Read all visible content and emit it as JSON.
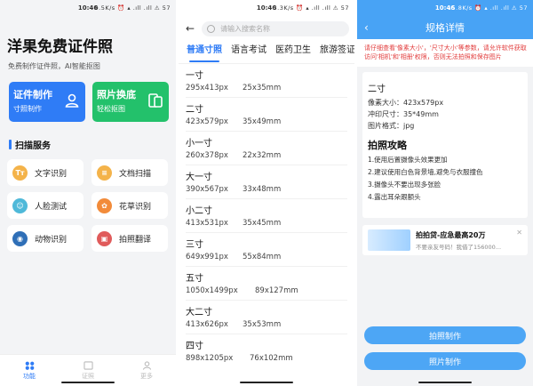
{
  "phone1": {
    "status": {
      "time": "10:46",
      "icons": "0.5K/s ⏰ ▴ .ıll .ıll ⚠ 57"
    },
    "title": "洋果免费证件照",
    "subtitle": "免费制作证件照，AI智能抠图",
    "card_make": {
      "title": "证件制作",
      "sub": "寸照制作"
    },
    "card_bg": {
      "title": "照片换底",
      "sub": "轻松抠图"
    },
    "section_title": "扫描服务",
    "services": [
      {
        "label": "文字识别",
        "icon": "Tт",
        "color": "#f4b34a"
      },
      {
        "label": "文档扫描",
        "icon": "≡",
        "color": "#f4b34a"
      },
      {
        "label": "人脸测试",
        "icon": "☺",
        "color": "#4fb9d9"
      },
      {
        "label": "花草识别",
        "icon": "✿",
        "color": "#f28b3a"
      },
      {
        "label": "动物识别",
        "icon": "◉",
        "color": "#2f6fb7"
      },
      {
        "label": "拍照翻译",
        "icon": "▣",
        "color": "#e05b5b"
      }
    ],
    "tabs": [
      {
        "label": "功能",
        "active": true
      },
      {
        "label": "证照",
        "active": false
      },
      {
        "label": "更多",
        "active": false
      }
    ]
  },
  "phone2": {
    "status": {
      "time": "10:46",
      "icons": "3.3K/s ⏰ ▴ .ıll .ıll ⚠ 57"
    },
    "search_placeholder": "请输入搜索名称",
    "categories": [
      "普通寸照",
      "语言考试",
      "医药卫生",
      "旅游签证"
    ],
    "sizes": [
      {
        "name": "一寸",
        "px": "295x413px",
        "mm": "25x35mm"
      },
      {
        "name": "二寸",
        "px": "423x579px",
        "mm": "35x49mm"
      },
      {
        "name": "小一寸",
        "px": "260x378px",
        "mm": "22x32mm"
      },
      {
        "name": "大一寸",
        "px": "390x567px",
        "mm": "33x48mm"
      },
      {
        "name": "小二寸",
        "px": "413x531px",
        "mm": "35x45mm"
      },
      {
        "name": "三寸",
        "px": "649x991px",
        "mm": "55x84mm"
      },
      {
        "name": "五寸",
        "px": "1050x1499px",
        "mm": "89x127mm"
      },
      {
        "name": "大二寸",
        "px": "413x626px",
        "mm": "35x53mm"
      },
      {
        "name": "四寸",
        "px": "898x1205px",
        "mm": "76x102mm"
      }
    ]
  },
  "phone3": {
    "status": {
      "time": "10:46",
      "icons": "15.8K/s ⏰ ▴ .ıll .ıll ⚠ 57"
    },
    "title": "规格详情",
    "warning": "请仔细查看'像素大小'，'尺寸大小'等参数，请允许软件获取访问'相机'和'相册'权限，否则无法拍照和保存图片",
    "spec": {
      "name": "二寸",
      "pixel_line": "像素大小：423x579px",
      "print_line": "冲印尺寸：35*49mm",
      "format_line": "图片格式：jpg"
    },
    "tips_title": "拍照攻略",
    "tips": [
      "1.使用后置摄像头效果更加",
      "2.建议使用白色背景墙,避免与衣服撞色",
      "3.摄像头不要出现多张脸",
      "4.露出耳朵跟额头"
    ],
    "ad": {
      "title": "拍拍贷-应急最高20万",
      "sub": "不要亲友号码！我借了156000..."
    },
    "btn_photo": "拍照制作",
    "btn_pick": "照片制作"
  }
}
